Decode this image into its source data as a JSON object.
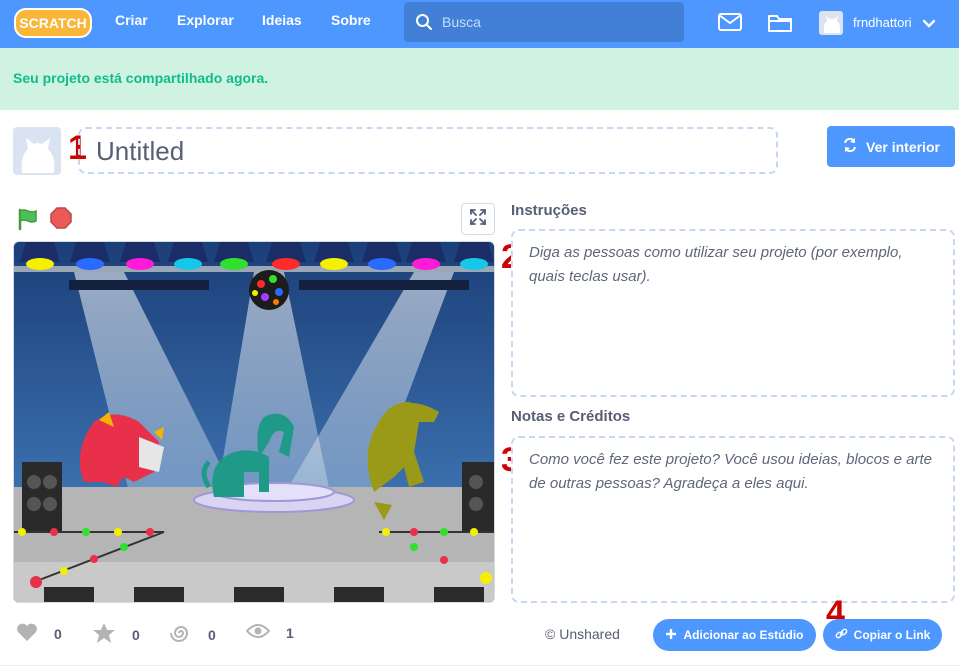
{
  "nav": {
    "logo_text": "SCRATCH",
    "links": [
      "Criar",
      "Explorar",
      "Ideias",
      "Sobre"
    ],
    "search_placeholder": "Busca",
    "username": "frndhattori"
  },
  "banner": {
    "message": "Seu projeto está compartilhado agora."
  },
  "project": {
    "title_value": "Untitled",
    "see_inside_label": "Ver interior"
  },
  "markers": [
    "1",
    "2",
    "3",
    "4"
  ],
  "instructions": {
    "label": "Instruções",
    "placeholder": "Diga as pessoas como utilizar seu projeto (por exemplo, quais teclas usar)."
  },
  "notes": {
    "label": "Notas e Créditos",
    "placeholder": "Como você fez este projeto? Você usou ideias, blocos e arte de outras pessoas? Agradeça a eles aqui."
  },
  "stats": {
    "loves": "0",
    "favorites": "0",
    "remixes": "0",
    "views": "1"
  },
  "sharing": {
    "status": "© Unshared",
    "add_to_studio_label": "Adicionar ao Estúdio",
    "copy_link_label": "Copiar o Link"
  },
  "colors": {
    "brand_blue": "#4d97ff",
    "banner_green_bg": "#cff2e2",
    "banner_green_text": "#0fbd8c",
    "marker_red": "#d10000",
    "flag_green": "#4cbf56",
    "stop_red": "#ec5959"
  },
  "icons": [
    "search-icon",
    "mail-icon",
    "folder-icon",
    "chevron-down-icon",
    "remix-icon",
    "green-flag-icon",
    "stop-icon",
    "fullscreen-icon",
    "heart-icon",
    "star-icon",
    "remix-swirl-icon",
    "eye-icon",
    "plus-icon",
    "link-icon"
  ]
}
